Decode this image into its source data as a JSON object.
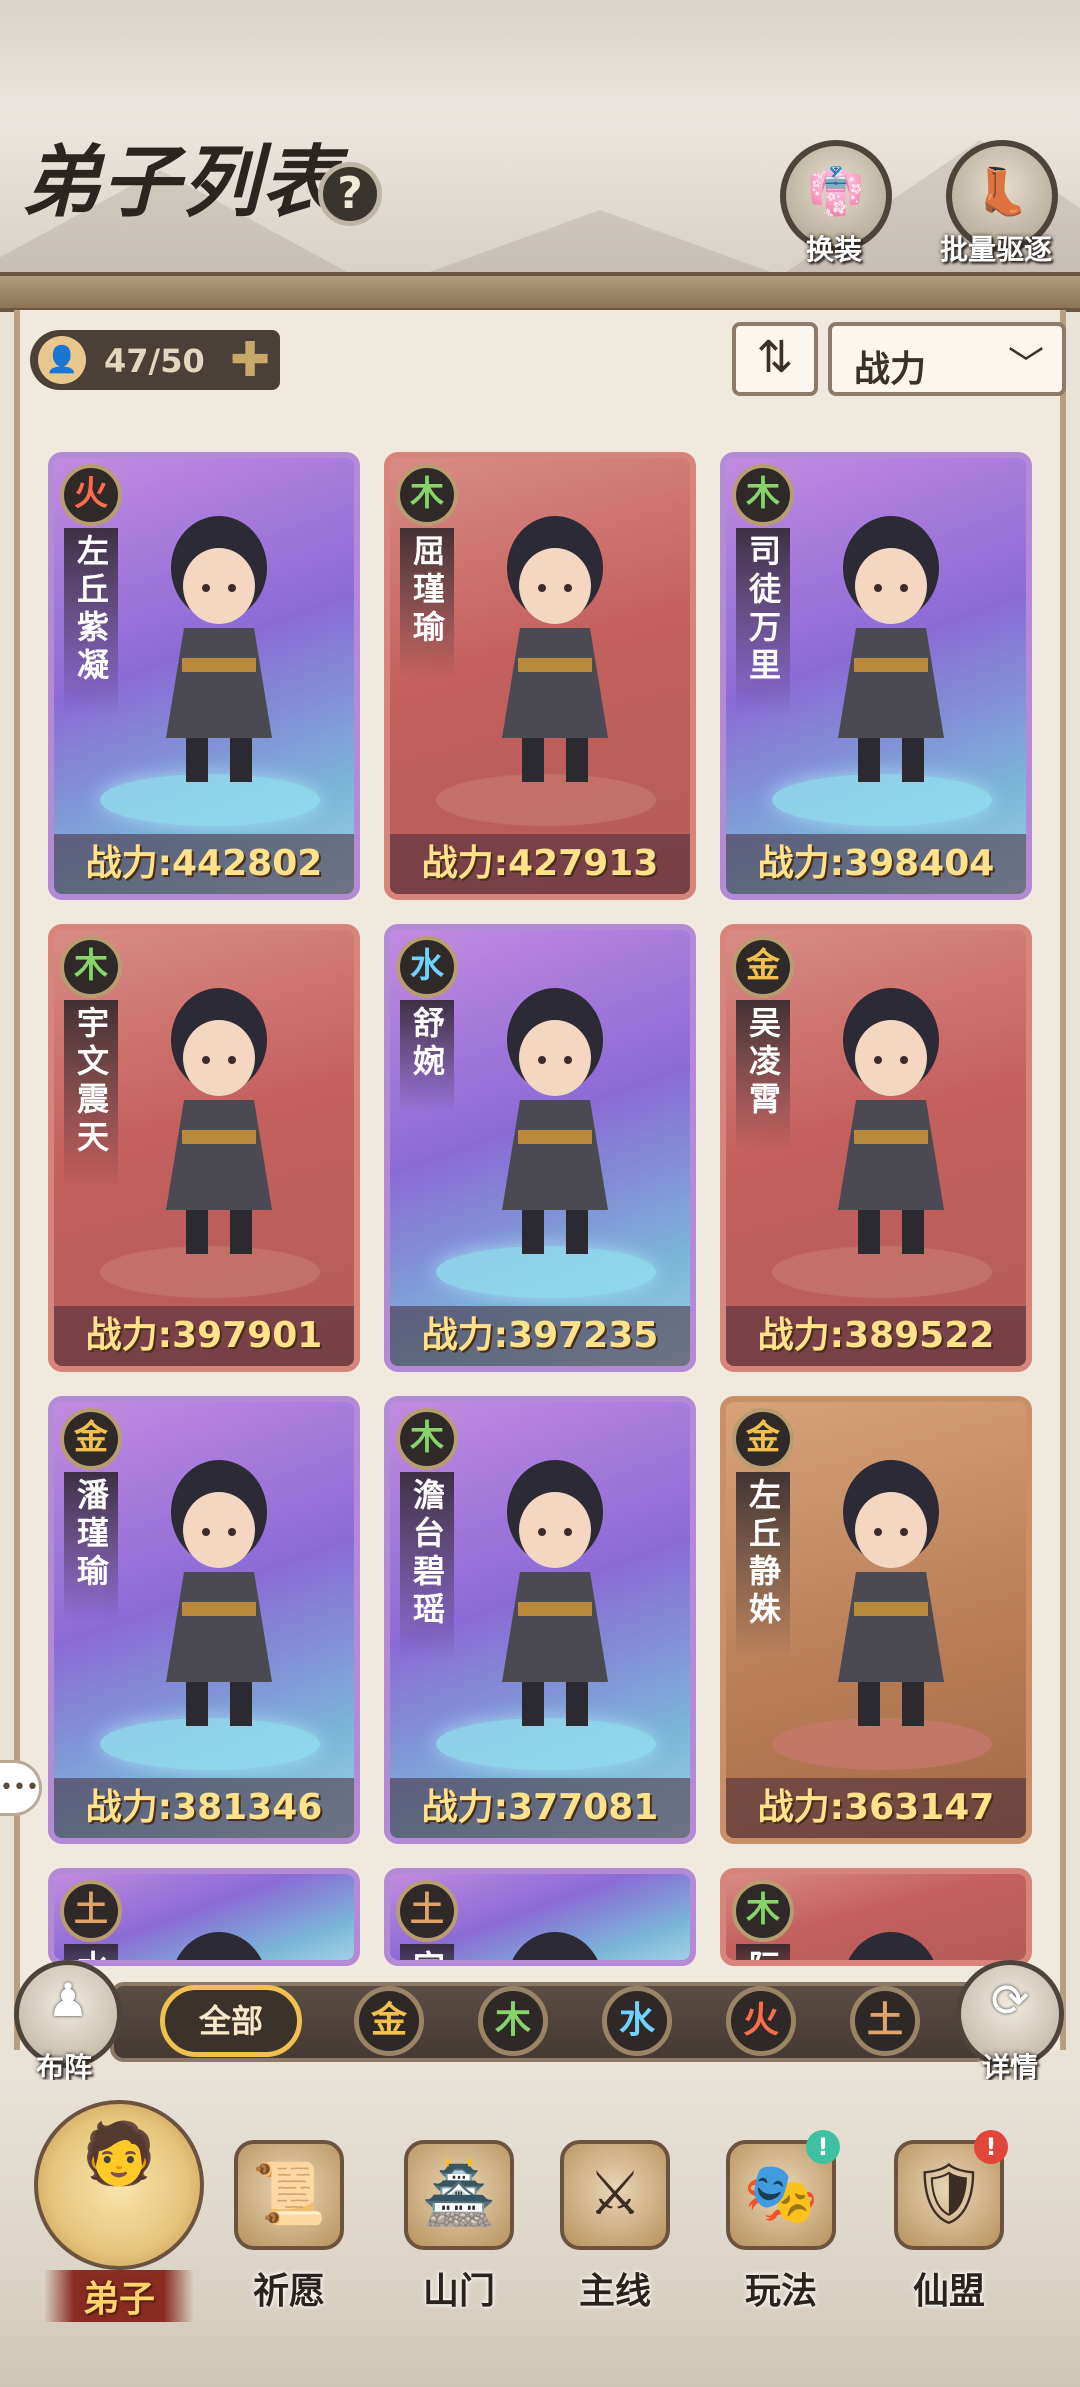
{
  "header": {
    "title": "弟子列表",
    "help_icon": "?",
    "buttons": [
      {
        "label": "换装",
        "icon": "outfit-icon"
      },
      {
        "label": "批量驱逐",
        "icon": "boot-icon"
      }
    ]
  },
  "toolbar": {
    "disciple_count": "47/50",
    "sort_value": "战力"
  },
  "cards": [
    {
      "element": "火",
      "name": "左丘紫凝",
      "power": "战力:442802",
      "bg": "purple"
    },
    {
      "element": "木",
      "name": "屈瑾瑜",
      "power": "战力:427913",
      "bg": "red"
    },
    {
      "element": "木",
      "name": "司徒万里",
      "power": "战力:398404",
      "bg": "purple"
    },
    {
      "element": "木",
      "name": "宇文震天",
      "power": "战力:397901",
      "bg": "red"
    },
    {
      "element": "水",
      "name": "舒婉",
      "power": "战力:397235",
      "bg": "purple"
    },
    {
      "element": "金",
      "name": "吴凌霄",
      "power": "战力:389522",
      "bg": "red"
    },
    {
      "element": "金",
      "name": "潘瑾瑜",
      "power": "战力:381346",
      "bg": "purple"
    },
    {
      "element": "木",
      "name": "澹台碧瑶",
      "power": "战力:377081",
      "bg": "purple"
    },
    {
      "element": "金",
      "name": "左丘静姝",
      "power": "战力:363147",
      "bg": "brown"
    },
    {
      "element": "土",
      "name": "水",
      "power": "",
      "bg": "purple"
    },
    {
      "element": "土",
      "name": "宫",
      "power": "",
      "bg": "purple"
    },
    {
      "element": "木",
      "name": "阮",
      "power": "",
      "bg": "red"
    }
  ],
  "filter": {
    "left_button": "布阵",
    "all_label": "全部",
    "elements": [
      "金",
      "木",
      "水",
      "火",
      "土"
    ],
    "right_button": "详情"
  },
  "nav": [
    {
      "label": "弟子",
      "active": true,
      "badge": ""
    },
    {
      "label": "祈愿",
      "active": false,
      "badge": ""
    },
    {
      "label": "山门",
      "active": false,
      "badge": ""
    },
    {
      "label": "主线",
      "active": false,
      "badge": ""
    },
    {
      "label": "玩法",
      "active": false,
      "badge": "!"
    },
    {
      "label": "仙盟",
      "active": false,
      "badge": "!"
    }
  ],
  "colors": {
    "fire": "#ff6b4d",
    "wood": "#86d46a",
    "water": "#6fd2ff",
    "gold": "#f2c04e",
    "earth": "#e0a36b",
    "power_text": "#ffe28a",
    "badge_green": "#3fc0a0",
    "badge_red": "#e0463a"
  }
}
